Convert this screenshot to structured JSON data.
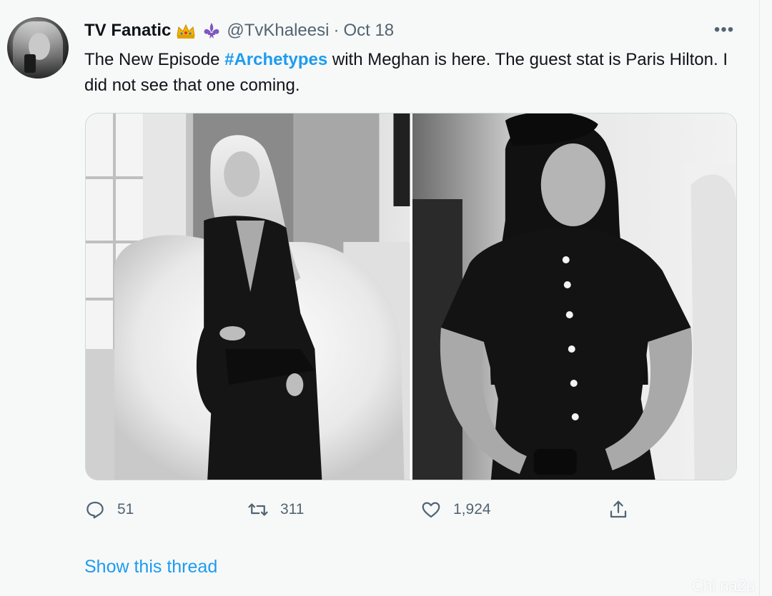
{
  "tweet": {
    "display_name": "TV Fanatic",
    "handle": "@TvKhaleesi",
    "separator": "·",
    "time": "Oct 18",
    "text_before": "The New Episode ",
    "hashtag": "#Archetypes",
    "text_after": " with Meghan is here. The guest stat is Paris Hilton. I did not see that one coming.",
    "emoji_icons": [
      "crown-icon",
      "fleur-de-lis-icon"
    ],
    "more_label": "•••"
  },
  "media": [
    {
      "icon": "photo-paris-hilton"
    },
    {
      "icon": "photo-meghan"
    }
  ],
  "actions": {
    "reply_count": "51",
    "retweet_count": "311",
    "like_count": "1,924"
  },
  "show_thread": "Show this thread",
  "watermark": "Chi na2u",
  "colors": {
    "accent": "#1d9bf0",
    "text": "#0f1419",
    "muted": "#536471",
    "background": "#f7f9f9"
  }
}
